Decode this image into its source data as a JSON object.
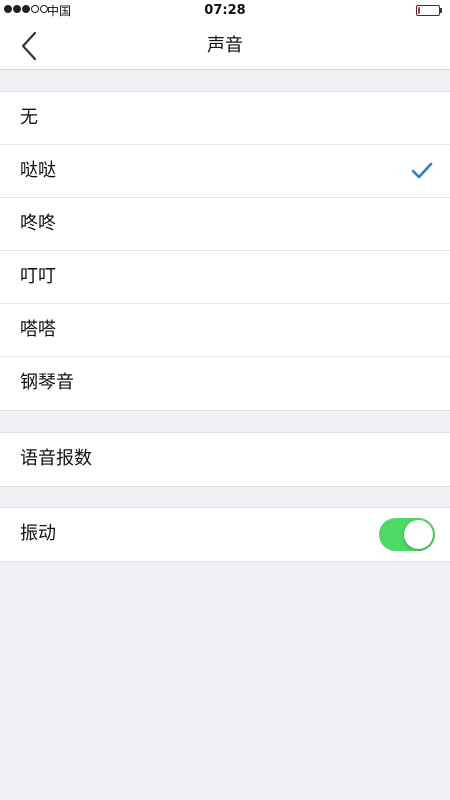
{
  "status_bar": {
    "carrier": "中国",
    "time": "07:28",
    "signal_bars_filled": 3,
    "signal_bars_total": 5,
    "battery_level": 0.1,
    "battery_color": "#e0202a"
  },
  "nav": {
    "back_icon": "chevron-left-icon",
    "title": "声音"
  },
  "sound_options": {
    "items": [
      {
        "label": "无",
        "selected": false
      },
      {
        "label": "哒哒",
        "selected": true
      },
      {
        "label": "咚咚",
        "selected": false
      },
      {
        "label": "叮叮",
        "selected": false
      },
      {
        "label": "嗒嗒",
        "selected": false
      },
      {
        "label": "钢琴音",
        "selected": false
      }
    ],
    "check_icon": "checkmark-icon",
    "check_color": "#2d7ec4"
  },
  "voice_section": {
    "label": "语音报数"
  },
  "vibration_section": {
    "label": "振动",
    "enabled": true,
    "toggle_color": "#4cd964"
  }
}
